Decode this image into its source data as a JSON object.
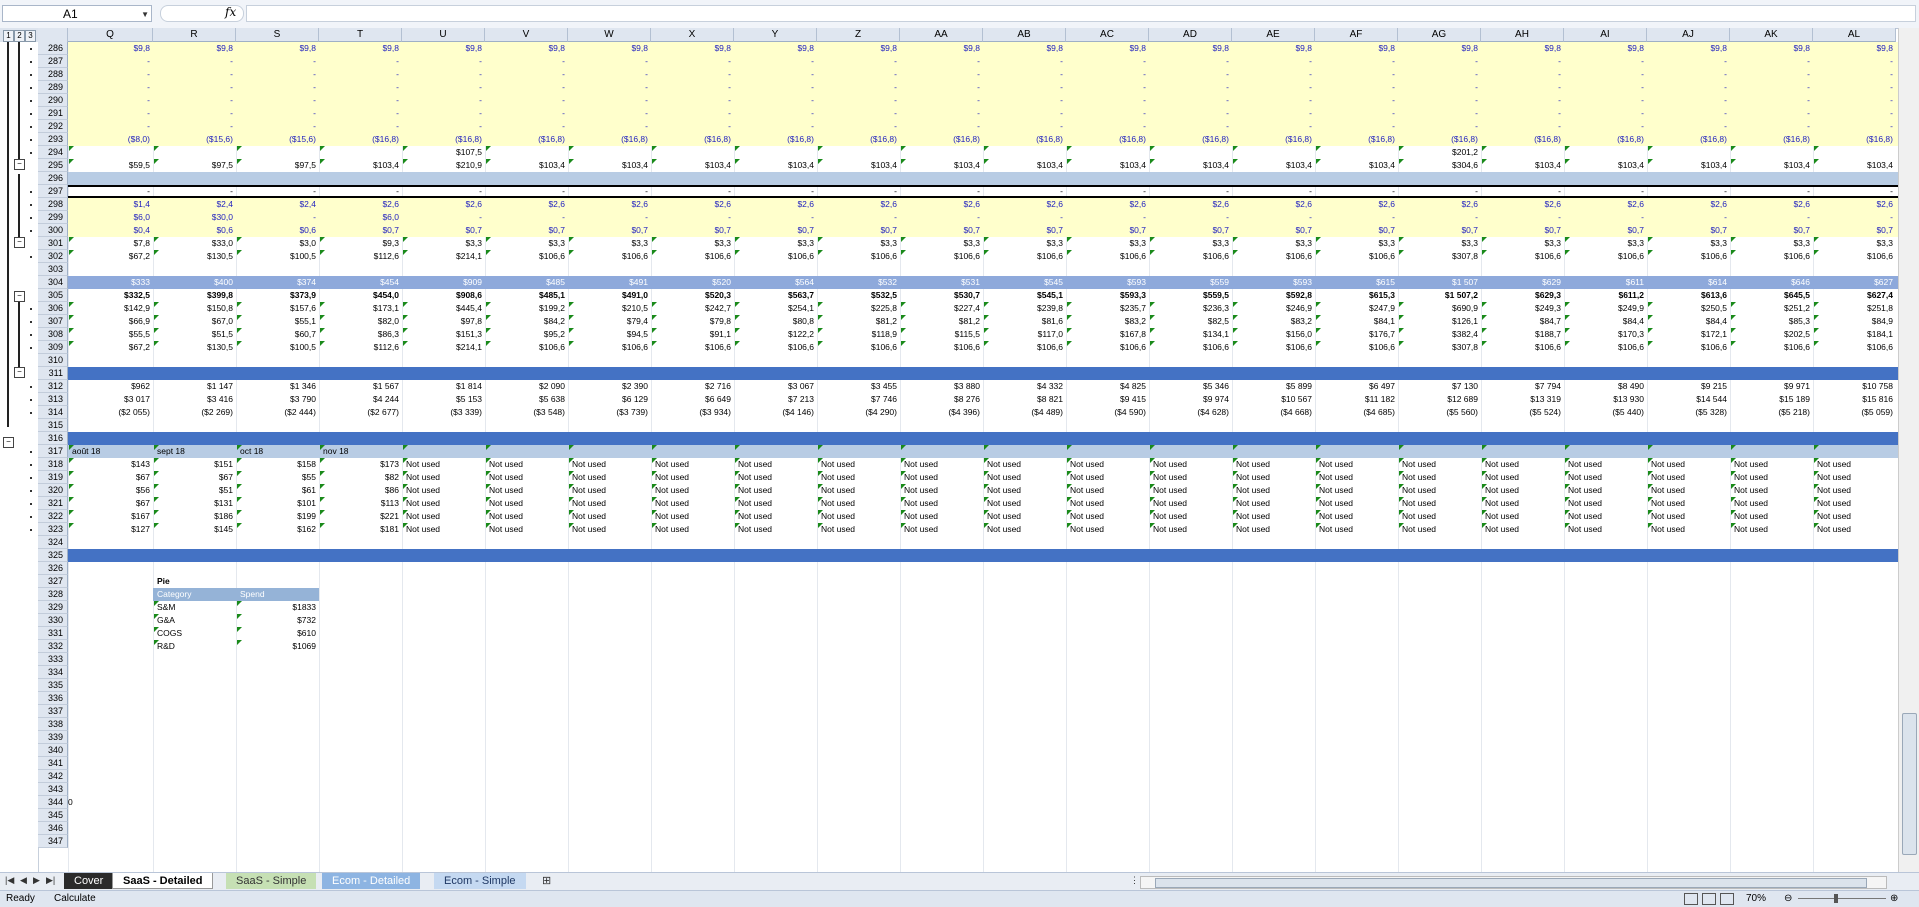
{
  "app": {
    "name_box": "A1",
    "formula_value": "",
    "outline_levels": [
      "1",
      "2",
      "3"
    ]
  },
  "columns": [
    "Q",
    "R",
    "S",
    "T",
    "U",
    "V",
    "W",
    "X",
    "Y",
    "Z",
    "AA",
    "AB",
    "AC",
    "AD",
    "AE",
    "AF",
    "AG",
    "AH",
    "AI",
    "AJ",
    "AK",
    "AL"
  ],
  "row_numbers": [
    "286",
    "287",
    "288",
    "289",
    "290",
    "291",
    "292",
    "293",
    "294",
    "295",
    "296",
    "297",
    "298",
    "299",
    "300",
    "301",
    "302",
    "303",
    "304",
    "305",
    "306",
    "307",
    "308",
    "309",
    "310",
    "311",
    "312",
    "313",
    "314",
    "315",
    "316",
    "317",
    "318",
    "319",
    "320",
    "321",
    "322",
    "323",
    "324",
    "325",
    "326",
    "327",
    "328",
    "329",
    "330",
    "331",
    "332",
    "333",
    "334",
    "335",
    "336",
    "337",
    "338",
    "339",
    "340",
    "341",
    "342",
    "343",
    "344",
    "345",
    "346",
    "347"
  ],
  "rows": {
    "r286": [
      "$9,8",
      "$9,8",
      "$9,8",
      "$9,8",
      "$9,8",
      "$9,8",
      "$9,8",
      "$9,8",
      "$9,8",
      "$9,8",
      "$9,8",
      "$9,8",
      "$9,8",
      "$9,8",
      "$9,8",
      "$9,8",
      "$9,8",
      "$9,8",
      "$9,8",
      "$9,8",
      "$9,8",
      "$9,8"
    ],
    "dash": [
      "-",
      "-",
      "-",
      "-",
      "-",
      "-",
      "-",
      "-",
      "-",
      "-",
      "-",
      "-",
      "-",
      "-",
      "-",
      "-",
      "-",
      "-",
      "-",
      "-",
      "-",
      "-"
    ],
    "r293": [
      "($8,0)",
      "($15,6)",
      "($15,6)",
      "($16,8)",
      "($16,8)",
      "($16,8)",
      "($16,8)",
      "($16,8)",
      "($16,8)",
      "($16,8)",
      "($16,8)",
      "($16,8)",
      "($16,8)",
      "($16,8)",
      "($16,8)",
      "($16,8)",
      "($16,8)",
      "($16,8)",
      "($16,8)",
      "($16,8)",
      "($16,8)",
      "($16,8)"
    ],
    "r294": [
      "",
      "",
      "",
      "",
      "$107,5",
      "",
      "",
      "",
      "",
      "",
      "",
      "",
      "",
      "",
      "",
      "",
      "$201,2",
      "",
      "",
      "",
      "",
      ""
    ],
    "r295": [
      "$59,5",
      "$97,5",
      "$97,5",
      "$103,4",
      "$210,9",
      "$103,4",
      "$103,4",
      "$103,4",
      "$103,4",
      "$103,4",
      "$103,4",
      "$103,4",
      "$103,4",
      "$103,4",
      "$103,4",
      "$103,4",
      "$304,6",
      "$103,4",
      "$103,4",
      "$103,4",
      "$103,4",
      "$103,4"
    ],
    "r297": [
      "-",
      "-",
      "-",
      "-",
      "-",
      "-",
      "-",
      "-",
      "-",
      "-",
      "-",
      "-",
      "-",
      "-",
      "-",
      "-",
      "-",
      "-",
      "-",
      "-",
      "-",
      "-"
    ],
    "r298": [
      "$1,4",
      "$2,4",
      "$2,4",
      "$2,6",
      "$2,6",
      "$2,6",
      "$2,6",
      "$2,6",
      "$2,6",
      "$2,6",
      "$2,6",
      "$2,6",
      "$2,6",
      "$2,6",
      "$2,6",
      "$2,6",
      "$2,6",
      "$2,6",
      "$2,6",
      "$2,6",
      "$2,6",
      "$2,6"
    ],
    "r299": [
      "$6,0",
      "$30,0",
      "-",
      "$6,0",
      "-",
      "-",
      "-",
      "-",
      "-",
      "-",
      "-",
      "-",
      "-",
      "-",
      "-",
      "-",
      "-",
      "-",
      "-",
      "-",
      "-",
      "-"
    ],
    "r300": [
      "$0,4",
      "$0,6",
      "$0,6",
      "$0,7",
      "$0,7",
      "$0,7",
      "$0,7",
      "$0,7",
      "$0,7",
      "$0,7",
      "$0,7",
      "$0,7",
      "$0,7",
      "$0,7",
      "$0,7",
      "$0,7",
      "$0,7",
      "$0,7",
      "$0,7",
      "$0,7",
      "$0,7",
      "$0,7"
    ],
    "r301": [
      "$7,8",
      "$33,0",
      "$3,0",
      "$9,3",
      "$3,3",
      "$3,3",
      "$3,3",
      "$3,3",
      "$3,3",
      "$3,3",
      "$3,3",
      "$3,3",
      "$3,3",
      "$3,3",
      "$3,3",
      "$3,3",
      "$3,3",
      "$3,3",
      "$3,3",
      "$3,3",
      "$3,3",
      "$3,3"
    ],
    "r302": [
      "$67,2",
      "$130,5",
      "$100,5",
      "$112,6",
      "$214,1",
      "$106,6",
      "$106,6",
      "$106,6",
      "$106,6",
      "$106,6",
      "$106,6",
      "$106,6",
      "$106,6",
      "$106,6",
      "$106,6",
      "$106,6",
      "$307,8",
      "$106,6",
      "$106,6",
      "$106,6",
      "$106,6",
      "$106,6"
    ],
    "r304": [
      "$333",
      "$400",
      "$374",
      "$454",
      "$909",
      "$485",
      "$491",
      "$520",
      "$564",
      "$532",
      "$531",
      "$545",
      "$593",
      "$559",
      "$593",
      "$615",
      "$1 507",
      "$629",
      "$611",
      "$614",
      "$646",
      "$627"
    ],
    "r305": [
      "$332,5",
      "$399,8",
      "$373,9",
      "$454,0",
      "$908,6",
      "$485,1",
      "$491,0",
      "$520,3",
      "$563,7",
      "$532,5",
      "$530,7",
      "$545,1",
      "$593,3",
      "$559,5",
      "$592,8",
      "$615,3",
      "$1 507,2",
      "$629,3",
      "$611,2",
      "$613,6",
      "$645,5",
      "$627,4"
    ],
    "r306": [
      "$142,9",
      "$150,8",
      "$157,6",
      "$173,1",
      "$445,4",
      "$199,2",
      "$210,5",
      "$242,7",
      "$254,1",
      "$225,8",
      "$227,4",
      "$239,8",
      "$235,7",
      "$236,3",
      "$246,9",
      "$247,9",
      "$690,9",
      "$249,3",
      "$249,9",
      "$250,5",
      "$251,2",
      "$251,8"
    ],
    "r307": [
      "$66,9",
      "$67,0",
      "$55,1",
      "$82,0",
      "$97,8",
      "$84,2",
      "$79,4",
      "$79,8",
      "$80,8",
      "$81,2",
      "$81,2",
      "$81,6",
      "$83,2",
      "$82,5",
      "$83,2",
      "$84,1",
      "$126,1",
      "$84,7",
      "$84,4",
      "$84,4",
      "$85,3",
      "$84,9"
    ],
    "r308": [
      "$55,5",
      "$51,5",
      "$60,7",
      "$86,3",
      "$151,3",
      "$95,2",
      "$94,5",
      "$91,1",
      "$122,2",
      "$118,9",
      "$115,5",
      "$117,0",
      "$167,8",
      "$134,1",
      "$156,0",
      "$176,7",
      "$382,4",
      "$188,7",
      "$170,3",
      "$172,1",
      "$202,5",
      "$184,1"
    ],
    "r309": [
      "$67,2",
      "$130,5",
      "$100,5",
      "$112,6",
      "$214,1",
      "$106,6",
      "$106,6",
      "$106,6",
      "$106,6",
      "$106,6",
      "$106,6",
      "$106,6",
      "$106,6",
      "$106,6",
      "$106,6",
      "$106,6",
      "$307,8",
      "$106,6",
      "$106,6",
      "$106,6",
      "$106,6",
      "$106,6"
    ],
    "r312": [
      "$962",
      "$1 147",
      "$1 346",
      "$1 567",
      "$1 814",
      "$2 090",
      "$2 390",
      "$2 716",
      "$3 067",
      "$3 455",
      "$3 880",
      "$4 332",
      "$4 825",
      "$5 346",
      "$5 899",
      "$6 497",
      "$7 130",
      "$7 794",
      "$8 490",
      "$9 215",
      "$9 971",
      "$10 758"
    ],
    "r313": [
      "$3 017",
      "$3 416",
      "$3 790",
      "$4 244",
      "$5 153",
      "$5 638",
      "$6 129",
      "$6 649",
      "$7 213",
      "$7 746",
      "$8 276",
      "$8 821",
      "$9 415",
      "$9 974",
      "$10 567",
      "$11 182",
      "$12 689",
      "$13 319",
      "$13 930",
      "$14 544",
      "$15 189",
      "$15 816"
    ],
    "r314": [
      "($2 055)",
      "($2 269)",
      "($2 444)",
      "($2 677)",
      "($3 339)",
      "($3 548)",
      "($3 739)",
      "($3 934)",
      "($4 146)",
      "($4 290)",
      "($4 396)",
      "($4 489)",
      "($4 590)",
      "($4 628)",
      "($4 668)",
      "($4 685)",
      "($5 560)",
      "($5 524)",
      "($5 440)",
      "($5 328)",
      "($5 218)",
      "($5 059)"
    ],
    "r317": [
      "août 18",
      "sept 18",
      "oct 18",
      "nov 18"
    ],
    "r318": [
      "$143",
      "$151",
      "$158",
      "$173"
    ],
    "r319": [
      "$67",
      "$67",
      "$55",
      "$82"
    ],
    "r320": [
      "$56",
      "$51",
      "$61",
      "$86"
    ],
    "r321": [
      "$67",
      "$131",
      "$101",
      "$113"
    ],
    "r322": [
      "$167",
      "$186",
      "$199",
      "$221"
    ],
    "r323": [
      "$127",
      "$145",
      "$162",
      "$181"
    ],
    "not_used": "Not used"
  },
  "pie_table": {
    "title": "Pie",
    "headers": [
      "Category",
      "Spend"
    ],
    "rows": [
      {
        "category": "S&M",
        "spend": "$1833"
      },
      {
        "category": "G&A",
        "spend": "$732"
      },
      {
        "category": "COGS",
        "spend": "$610"
      },
      {
        "category": "R&D",
        "spend": "$1069"
      }
    ]
  },
  "stray_text": "0",
  "tabs": [
    {
      "label": "Cover",
      "style": "dark"
    },
    {
      "label": "SaaS - Detailed",
      "style": "active"
    },
    {
      "label": "SaaS - Simple",
      "style": "green"
    },
    {
      "label": "Ecom - Detailed",
      "style": "blue"
    },
    {
      "label": "Ecom - Simple",
      "style": "light"
    }
  ],
  "status": {
    "left": [
      "Ready",
      "Calculate"
    ],
    "zoom": "70%"
  },
  "colors": {
    "yellow_band": "#ffffcc",
    "light_band": "#b8cce4",
    "dark_band": "#4472c4",
    "blue_text": "#1f1fbf"
  }
}
